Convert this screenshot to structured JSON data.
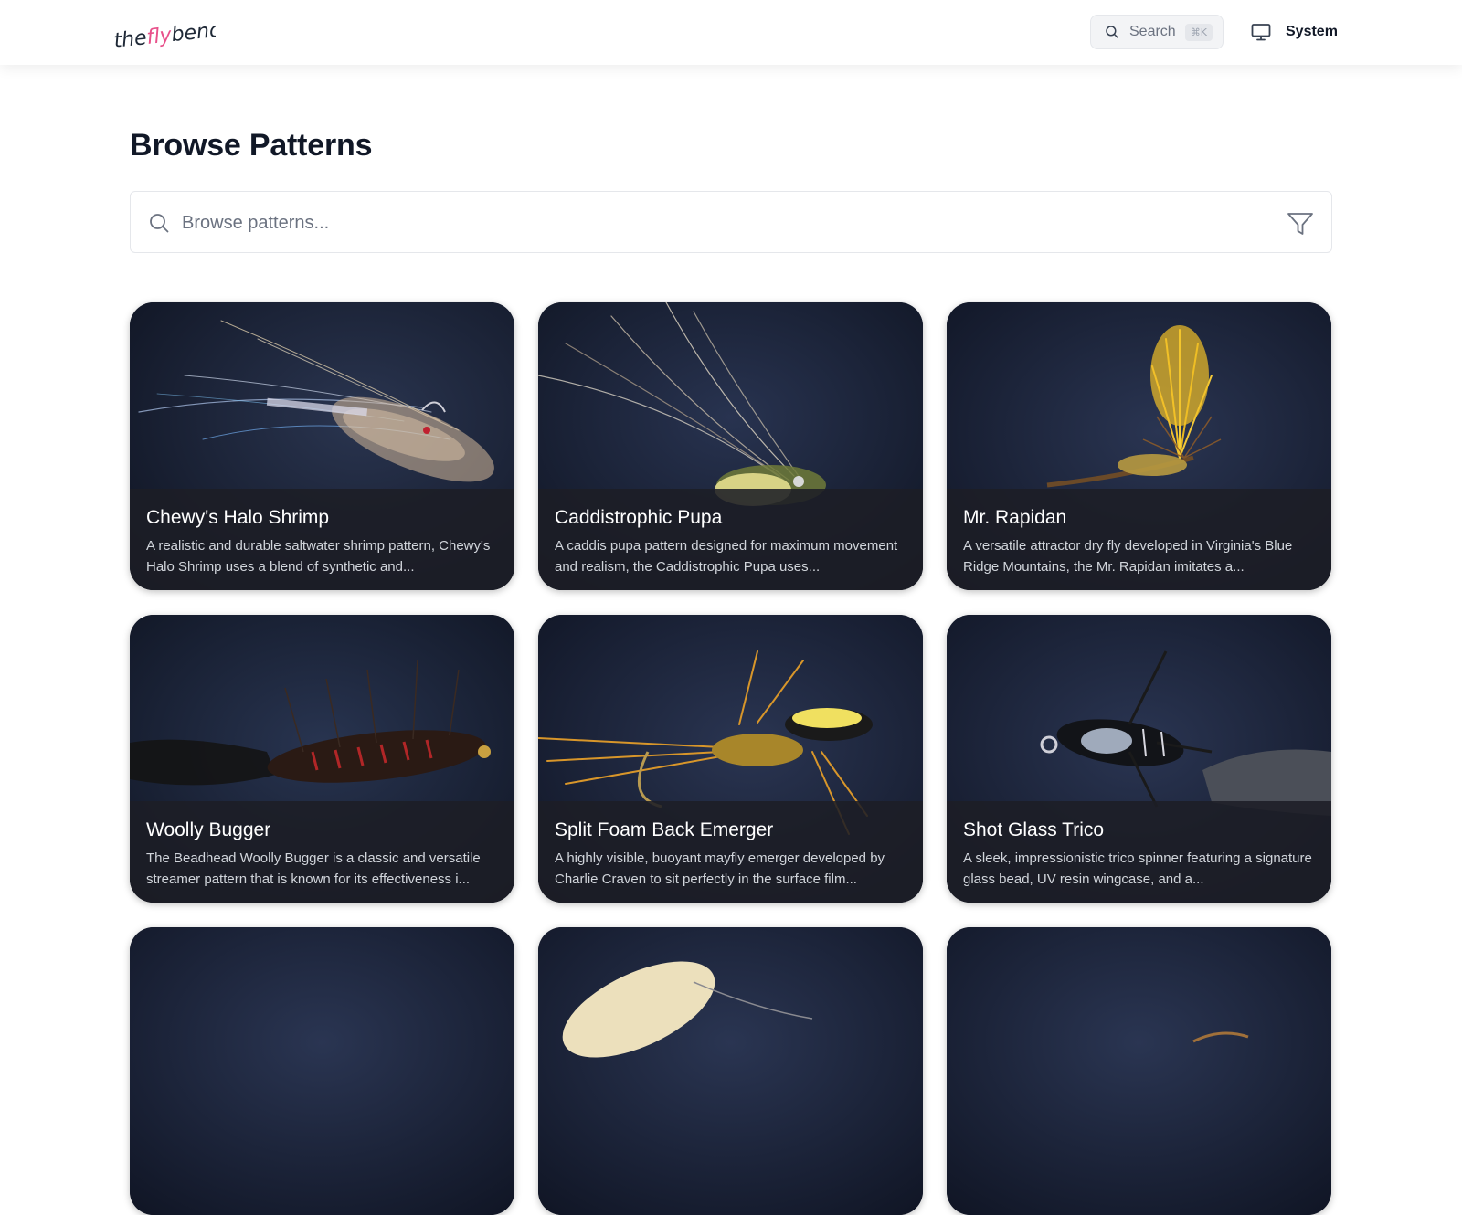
{
  "header": {
    "logo": {
      "part1": "the",
      "part2": "fly",
      "part3": "bench"
    },
    "search": {
      "label": "Search",
      "shortcut": "⌘K"
    },
    "theme": {
      "label": "System",
      "icon": "monitor-icon"
    }
  },
  "main": {
    "title": "Browse Patterns",
    "browse": {
      "placeholder": "Browse patterns...",
      "value": ""
    },
    "cards": [
      {
        "title": "Chewy's Halo Shrimp",
        "description": "A realistic and durable saltwater shrimp pattern, Chewy's Halo Shrimp uses a blend of synthetic and..."
      },
      {
        "title": "Caddistrophic Pupa",
        "description": "A caddis pupa pattern designed for maximum movement and realism, the Caddistrophic Pupa uses..."
      },
      {
        "title": "Mr. Rapidan",
        "description": "A versatile attractor dry fly developed in Virginia's Blue Ridge Mountains, the Mr. Rapidan imitates a..."
      },
      {
        "title": "Woolly Bugger",
        "description": "The Beadhead Woolly Bugger is a classic and versatile streamer pattern that is known for its effectiveness i..."
      },
      {
        "title": "Split Foam Back Emerger",
        "description": "A highly visible, buoyant mayfly emerger developed by Charlie Craven to sit perfectly in the surface film..."
      },
      {
        "title": "Shot Glass Trico",
        "description": "A sleek, impressionistic trico spinner featuring a signature glass bead, UV resin wingcase, and a..."
      }
    ]
  },
  "colors": {
    "logo_accent": "#e8508a",
    "card_background": "#1b2235",
    "card_overlay": "#1c1e26"
  }
}
